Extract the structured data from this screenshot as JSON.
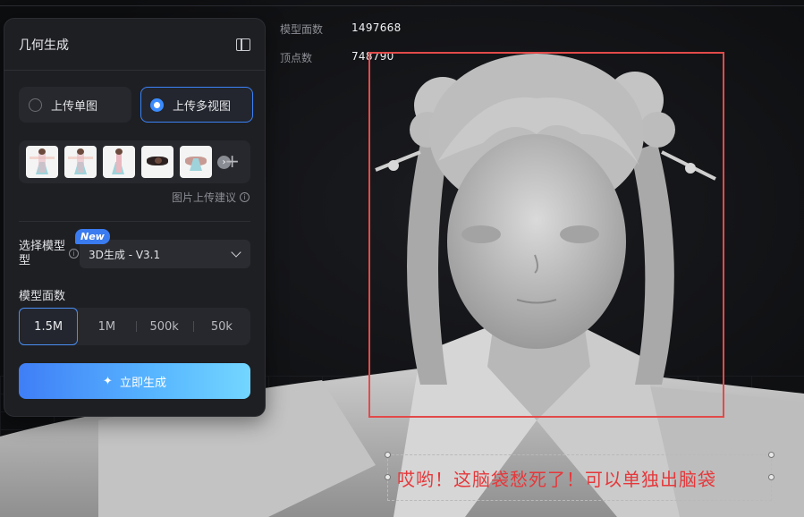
{
  "stats": {
    "faces_label": "模型面数",
    "faces_value": "1497668",
    "vertices_label": "顶点数",
    "vertices_value": "748790"
  },
  "panel": {
    "title": "几何生成",
    "upload_modes": [
      {
        "label": "上传单图",
        "selected": false
      },
      {
        "label": "上传多视图",
        "selected": true
      }
    ],
    "thumbnail_count": 5,
    "upload_hint": "图片上传建议",
    "model_label": "选择模型型",
    "model_new_badge": "New",
    "model_value": "3D生成 - V3.1",
    "faces_section_label": "模型面数",
    "face_options": [
      "1.5M",
      "1M",
      "500k",
      "50k"
    ],
    "face_selected": "1.5M",
    "generate_label": "立即生成"
  },
  "annotation": {
    "text": "哎哟！这脑袋愁死了！可以单独出脑袋"
  },
  "colors": {
    "accent": "#3b82f6",
    "selection_box": "#e24a4a",
    "annotation_text": "#e5383b",
    "panel_bg": "#1e1f23"
  },
  "icons": {
    "collapse": "sidebar-collapse-icon",
    "plus": "plus-icon",
    "info": "info-icon",
    "chevron": "chevron-down-icon",
    "sparkle": "sparkle-icon",
    "next": "chevron-right-icon"
  }
}
